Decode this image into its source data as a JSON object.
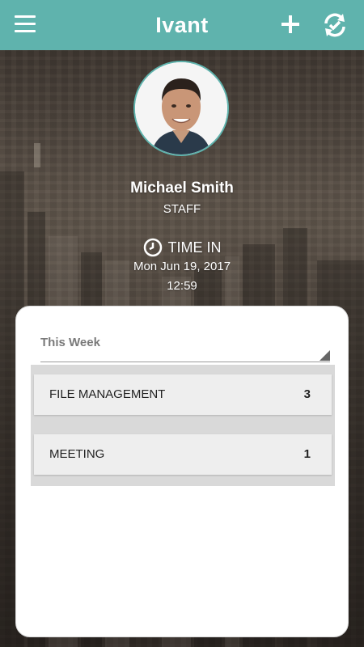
{
  "header": {
    "title": "Ivant",
    "menu_icon": "menu-icon",
    "add_icon": "plus-icon",
    "sync_icon": "sync-check-icon",
    "color": "#5fb3ad"
  },
  "profile": {
    "name": "Michael Smith",
    "role": "STAFF"
  },
  "attendance": {
    "status": "TIME IN",
    "status_icon": "clock-icon",
    "date": "Mon Jun 19, 2017",
    "time": "12:59"
  },
  "summary": {
    "period": "This Week",
    "activities": [
      {
        "name": "FILE MANAGEMENT",
        "count": "3"
      },
      {
        "name": "MEETING",
        "count": "1"
      }
    ]
  }
}
